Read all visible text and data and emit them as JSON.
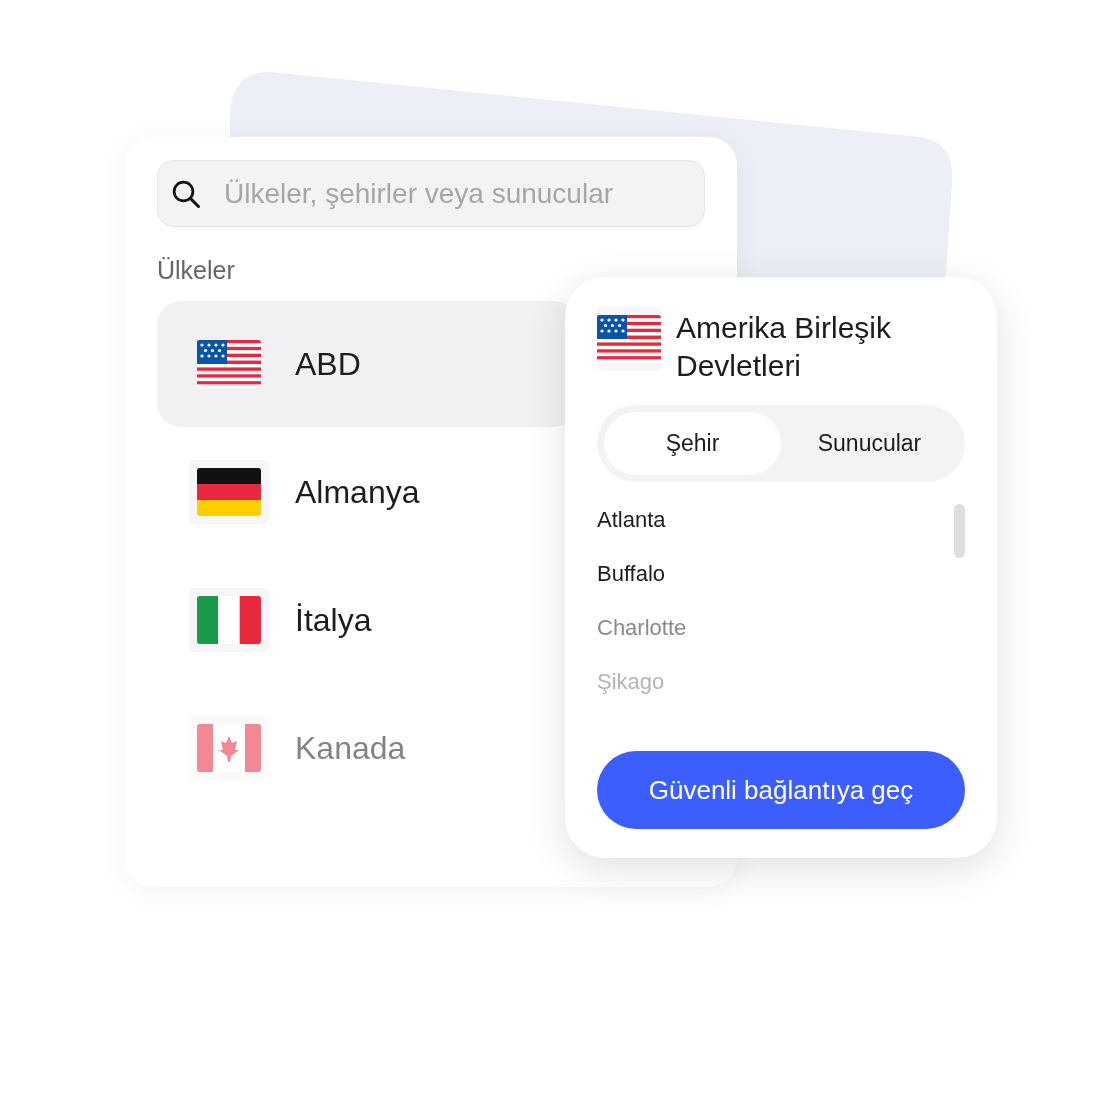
{
  "search": {
    "placeholder": "Ülkeler, şehirler veya sunucular"
  },
  "section_label": "Ülkeler",
  "countries": [
    {
      "name": "ABD",
      "kind": "us",
      "selected": true
    },
    {
      "name": "Almanya",
      "kind": "de",
      "selected": false
    },
    {
      "name": "İtalya",
      "kind": "it",
      "selected": false
    },
    {
      "name": "Kanada",
      "kind": "ca",
      "selected": false
    }
  ],
  "detail": {
    "kind": "us",
    "title": "Amerika Birleşik Devletleri",
    "tabs": [
      {
        "label": "Şehir",
        "selected": true
      },
      {
        "label": "Sunucular",
        "selected": false
      }
    ],
    "cities": [
      "Atlanta",
      "Buffalo",
      "Charlotte",
      "Şikago"
    ],
    "button": "Güvenli bağlantıya geç"
  }
}
